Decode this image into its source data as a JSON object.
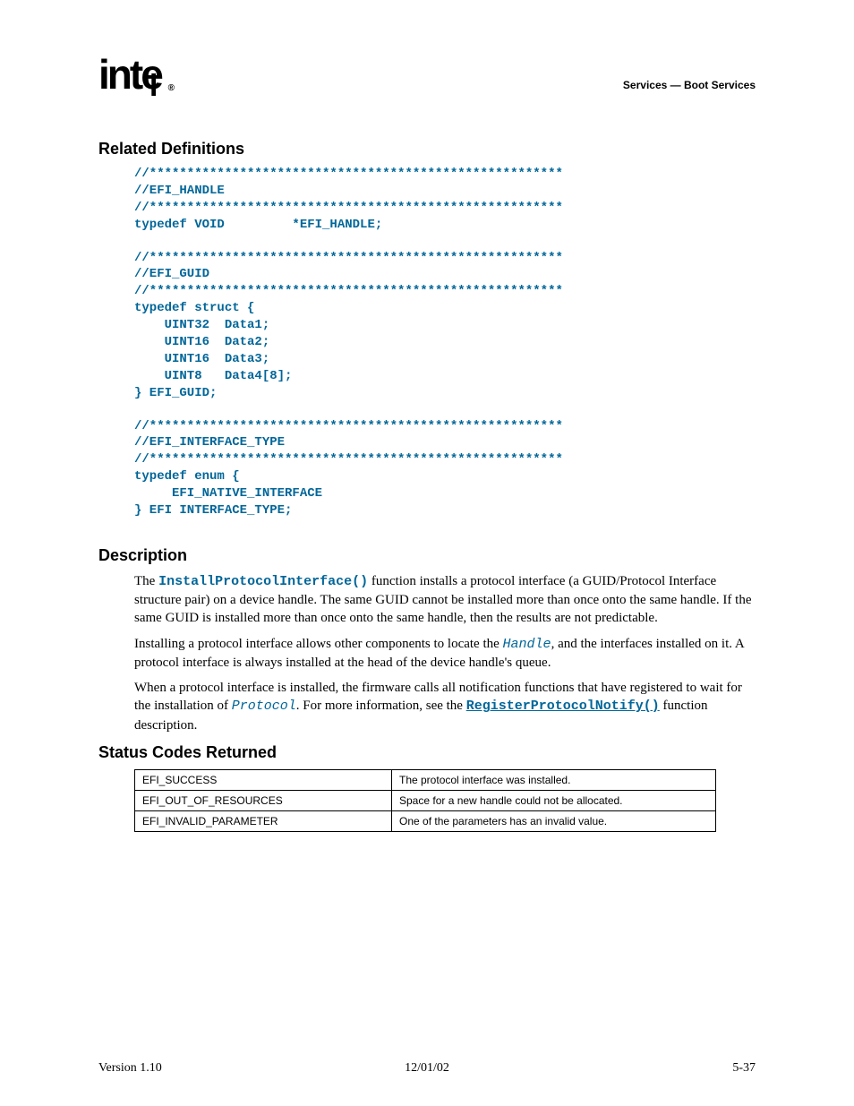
{
  "header": {
    "logo_text": "intel",
    "section_header": "Services — Boot Services"
  },
  "sections": {
    "related_definitions_title": "Related Definitions",
    "description_title": "Description",
    "status_codes_title": "Status Codes Returned"
  },
  "code": {
    "block1": "//*******************************************************\n//EFI_HANDLE\n//*******************************************************\ntypedef VOID         *EFI_HANDLE;",
    "block2": "//*******************************************************\n//EFI_GUID\n//*******************************************************\ntypedef struct {          \n    UINT32  Data1;\n    UINT16  Data2;\n    UINT16  Data3;\n    UINT8   Data4[8];\n} EFI_GUID;",
    "block3": "//*******************************************************\n//EFI_INTERFACE_TYPE\n//*******************************************************\ntypedef enum {\n     EFI_NATIVE_INTERFACE\n} EFI INTERFACE_TYPE;"
  },
  "description": {
    "p1_pre": "The ",
    "p1_code": "InstallProtocolInterface()",
    "p1_post": " function installs a protocol interface (a GUID/Protocol Interface structure pair) on a device handle.  The same GUID cannot be installed more than once onto the same handle.  If the same GUID is installed more than once onto the same handle, then the results are not predictable.",
    "p2_pre": "Installing a protocol interface allows other components to locate the ",
    "p2_code": "Handle",
    "p2_post": ", and the interfaces installed on it.  A protocol interface is always installed at the head of the device handle's queue.",
    "p3_pre": "When a protocol interface is installed, the firmware calls all notification functions that have registered to wait for the installation of ",
    "p3_code1": "Protocol",
    "p3_mid": ".  For more information, see the ",
    "p3_code2": "RegisterProtocolNotify()",
    "p3_post": " function description."
  },
  "status_table": {
    "rows": [
      {
        "code": "EFI_SUCCESS",
        "desc": "The protocol interface was installed."
      },
      {
        "code": "EFI_OUT_OF_RESOURCES",
        "desc": "Space for a new handle could not be allocated."
      },
      {
        "code": "EFI_INVALID_PARAMETER",
        "desc": "One of the parameters has an invalid value."
      }
    ]
  },
  "footer": {
    "version": "Version 1.10",
    "date": "12/01/02",
    "page": "5-37"
  }
}
